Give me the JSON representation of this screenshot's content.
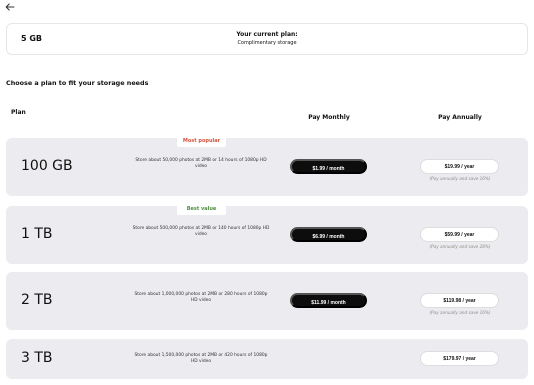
{
  "header": {
    "back_icon": "arrow-left-icon"
  },
  "current_plan": {
    "size": "5 GB",
    "title": "Your current plan:",
    "subtitle": "Complimentary storage"
  },
  "section": {
    "title": "Choose a plan to fit your storage needs",
    "plan_header": "Plan",
    "monthly_header": "Pay Monthly",
    "annually_header": "Pay Annually"
  },
  "plans": [
    {
      "size": "100 GB",
      "badge": "Most popular",
      "description": "Store about 50,000 photos at 2MB or 14 hours of 1080p HD video",
      "monthly": "$1.99 / month",
      "annual": "$19.99 / year",
      "annual_note": "(Pay annually and save 16%)"
    },
    {
      "size": "1 TB",
      "badge": "Best value",
      "description": "Store about 500,000 photos at 2MB or 140 hours of 1080p HD video",
      "monthly": "$6.99 / month",
      "annual": "$59.99 / year",
      "annual_note": "(Pay annually and save 28%)"
    },
    {
      "size": "2 TB",
      "badge": "",
      "description": "Store about 1,000,000 photos at 2MB or 280 hours of 1080p HD video",
      "monthly": "$11.99 / month",
      "annual": "$119.98 / year",
      "annual_note": "(Pay annually and save 16%)"
    },
    {
      "size": "3 TB",
      "badge": "",
      "description": "Store about 1,500,000 photos at 2MB or 420 hours of 1080p HD video",
      "monthly": "",
      "annual": "$179.97 / year",
      "annual_note": ""
    }
  ]
}
